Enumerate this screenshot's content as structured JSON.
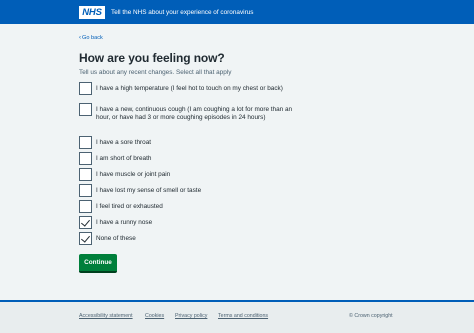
{
  "header": {
    "logo": "NHS",
    "service_name": "Tell the NHS about your experience of coronavirus"
  },
  "back_link": "Go back",
  "title": "How are you feeling now?",
  "hint": "Tell us about any recent changes. Select all that apply",
  "options": [
    {
      "label": "I have a high temperature (I feel hot to touch on my chest or back)",
      "checked": false
    },
    {
      "label": "I have a new, continuous cough (I am coughing a lot for more than an hour, or have had 3 or more coughing episodes in 24 hours)",
      "checked": false
    },
    {
      "label": "I have a sore throat",
      "checked": false
    },
    {
      "label": "I am short of breath",
      "checked": false
    },
    {
      "label": "I have muscle or joint pain",
      "checked": false
    },
    {
      "label": "I have lost my sense of smell or taste",
      "checked": false
    },
    {
      "label": "I feel tired or exhausted",
      "checked": false
    },
    {
      "label": "I have a runny nose",
      "checked": true
    },
    {
      "label": "None of these",
      "checked": true
    }
  ],
  "continue_label": "Continue",
  "footer": {
    "links": [
      "Accessibility statement",
      "Cookies",
      "Privacy policy",
      "Terms and conditions"
    ],
    "copyright": "© Crown copyright"
  },
  "colors": {
    "brand": "#005eb8",
    "button": "#007f3b",
    "background": "#f0f4f5"
  }
}
